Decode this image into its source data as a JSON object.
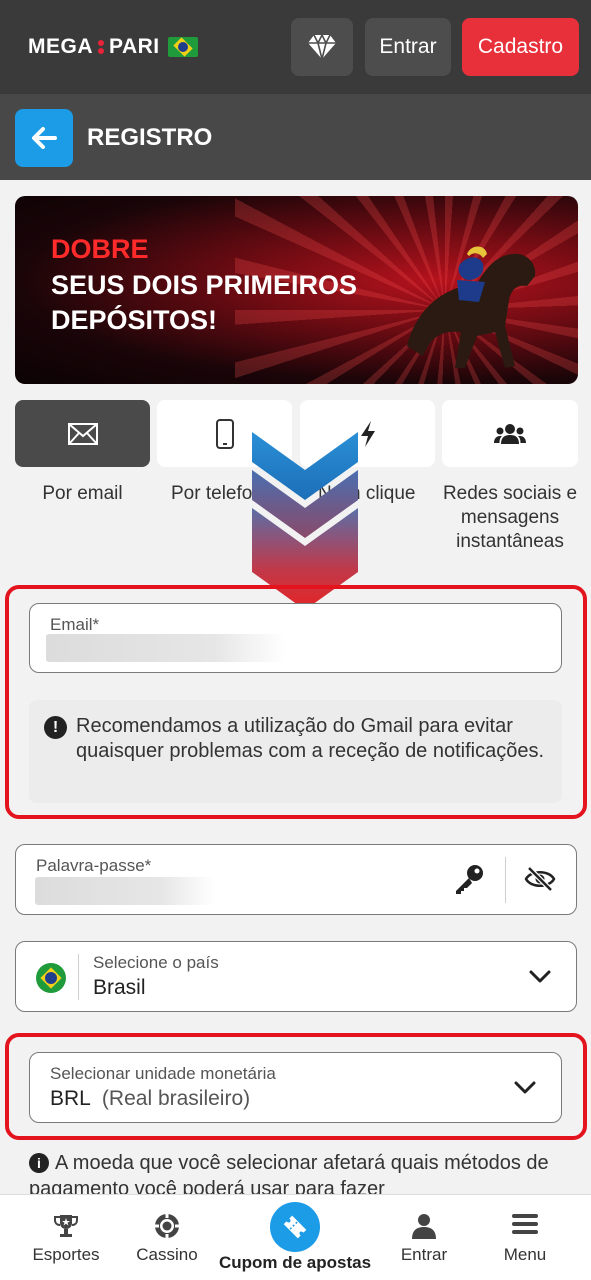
{
  "header": {
    "logo_text_left": "MEGA",
    "logo_text_right": "PARI",
    "login_label": "Entrar",
    "signup_label": "Cadastro"
  },
  "subheader": {
    "title": "REGISTRO"
  },
  "banner": {
    "line1": "DOBRE",
    "line2": "SEUS DOIS PRIMEIROS DEPÓSITOS!"
  },
  "tabs": [
    {
      "label": "Por email",
      "icon": "envelope-icon",
      "active": true
    },
    {
      "label": "Por telefone",
      "icon": "phone-icon",
      "active": false
    },
    {
      "label": "Num clique",
      "icon": "lightning-icon",
      "active": false
    },
    {
      "label": "Redes sociais e mensagens instantâneas",
      "icon": "users-icon",
      "active": false
    }
  ],
  "tab_labels_visible": {
    "t2": "Por telefo",
    "t3": "N",
    "t3b": "m clique"
  },
  "form": {
    "email_label": "Email*",
    "email_notice": "Recomendamos a utilização do Gmail para evitar quaisquer problemas com a receção de notificações.",
    "password_label": "Palavra-passe*",
    "country_label": "Selecione o país",
    "country_value": "Brasil",
    "currency_label": "Selecionar unidade monetária",
    "currency_code": "BRL",
    "currency_name": "(Real brasileiro)",
    "currency_notice": "A moeda que você selecionar afetará quais métodos de pagamento você poderá usar para fazer"
  },
  "bottom_nav": [
    {
      "label": "Esportes",
      "icon": "trophy-icon"
    },
    {
      "label": "Cassino",
      "icon": "casino-chip-icon"
    },
    {
      "label": "Cupom de apostas",
      "icon": "ticket-icon"
    },
    {
      "label": "Entrar",
      "icon": "user-icon"
    },
    {
      "label": "Menu",
      "icon": "menu-icon"
    }
  ],
  "colors": {
    "accent_blue": "#1c9be6",
    "accent_red": "#e8303a",
    "highlight_red": "#e4141e",
    "header_bg": "#3a3a3a"
  }
}
